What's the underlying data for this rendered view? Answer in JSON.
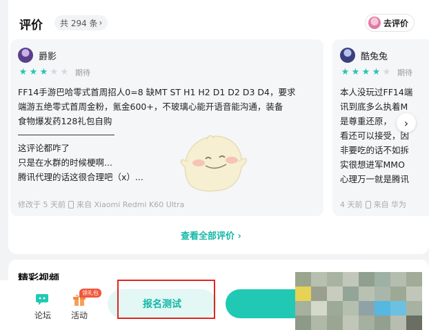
{
  "reviews_section": {
    "title": "评价",
    "count_label": "共 294 条",
    "count_chevron": "›",
    "go_review_label": "去评价"
  },
  "reviews": [
    {
      "username": "爵影",
      "stars_on": 3,
      "stars_total": 5,
      "rating_word": "期待",
      "lines_top": [
        "FF14手游巴哈零式首周招人0=8 缺MT ST H1 H2 D1 D2 D3 D4，要求",
        "端游五绝零式首周金粉，氪金600+，不玻璃心能开语音能沟通，装备",
        "食物爆发药128礼包自购"
      ],
      "lines_bottom": [
        "这评论都咋了",
        "只是在水群的时候梗啊...",
        "腾讯代理的话这很合理吧（x）..."
      ],
      "meta_time": "修改于 5 天前",
      "meta_device": "来自 Xiaomi Redmi K60 Ultra"
    },
    {
      "username": "酷兔兔",
      "stars_on": 4,
      "stars_total": 5,
      "rating_word": "期待",
      "lines_top": [
        "本人没玩过FF14端",
        "讯到底多么执着M",
        "是尊重还原，",
        "看还可以接受，因",
        "非要吃的话不如拆",
        "实很想进军MMO",
        "心理万一就是腾讯"
      ],
      "meta_time": "4 天前",
      "meta_device": "来自 华为"
    }
  ],
  "see_all_label": "查看全部评价 ›",
  "next_arrow": "›",
  "section2": {
    "title": "精彩视频"
  },
  "bottom_bar": {
    "forum_label": "论坛",
    "activity_label": "活动",
    "activity_badge": "领礼包",
    "signup_label": "报名测试"
  },
  "colors": {
    "accent": "#13b8a6",
    "star_on": "#27c3b0",
    "primary_button": "#21c9b4",
    "highlight_box": "#e0251b"
  }
}
